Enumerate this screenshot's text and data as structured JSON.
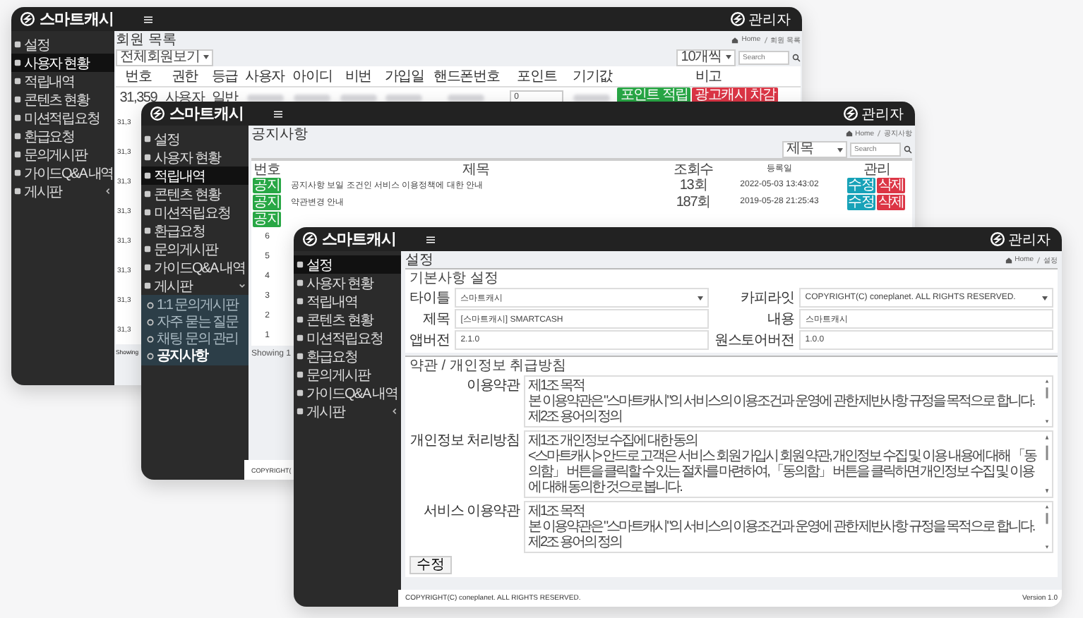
{
  "windows": [
    {
      "kind": "members",
      "logo": "스마트캐시",
      "admin": "관리자",
      "sidebar": [
        {
          "label": "설정",
          "selected": false
        },
        {
          "label": "사용자 현황",
          "selected": true
        },
        {
          "label": "적립내역",
          "selected": false
        },
        {
          "label": "콘텐츠 현황",
          "selected": false
        },
        {
          "label": "미션적립요청",
          "selected": false
        },
        {
          "label": "환급요청",
          "selected": false
        },
        {
          "label": "문의게시판",
          "selected": false
        },
        {
          "label": "가이드Q&A 내역",
          "selected": false
        },
        {
          "label": "게시판",
          "selected": false,
          "expanded": false
        }
      ],
      "title": "회원 목록",
      "breadcrumb": [
        "Home",
        "회원 목록"
      ],
      "filter": "전체회원보기",
      "page_size": "10개씩",
      "search": {
        "placeholder": "Search"
      },
      "table": {
        "columns": [
          "번호",
          "권한",
          "등급",
          "사용자",
          "아이디",
          "비번",
          "가입일",
          "핸드폰번호",
          "포인트",
          "기기값",
          "비고"
        ],
        "rows": [
          {
            "cells": [
              {
                "kind": "text",
                "text": "31,359"
              },
              {
                "kind": "text",
                "text": "사용자"
              },
              {
                "kind": "text",
                "text": "일반"
              },
              {
                "kind": "blur"
              },
              {
                "kind": "blur"
              },
              {
                "kind": "blur"
              },
              {
                "kind": "blur"
              },
              {
                "kind": "blur"
              },
              {
                "kind": "input",
                "value": "0"
              },
              {
                "kind": "blur"
              },
              {
                "kind": "buttons",
                "buttons": [
                  {
                    "label": "포인트 적립",
                    "color": "#28a745"
                  },
                  {
                    "label": "광고캐시 차감",
                    "color": "#dc3545"
                  }
                ]
              }
            ]
          },
          {
            "cells": [
              {
                "kind": "text",
                "text": "31,3"
              }
            ]
          },
          {
            "cells": [
              {
                "kind": "text",
                "text": "31,3"
              }
            ]
          },
          {
            "cells": [
              {
                "kind": "text",
                "text": "31,3"
              }
            ]
          },
          {
            "cells": [
              {
                "kind": "text",
                "text": "31,3"
              }
            ]
          },
          {
            "cells": [
              {
                "kind": "text",
                "text": "31,3"
              }
            ]
          },
          {
            "cells": [
              {
                "kind": "text",
                "text": "31,3"
              }
            ]
          },
          {
            "cells": [
              {
                "kind": "text",
                "text": "31,3"
              }
            ]
          },
          {
            "cells": [
              {
                "kind": "text",
                "text": "31,3"
              }
            ]
          }
        ]
      },
      "footer": "Showing"
    },
    {
      "kind": "notices",
      "logo": "스마트캐시",
      "admin": "관리자",
      "sidebar": [
        {
          "label": "설정",
          "selected": false
        },
        {
          "label": "사용자 현황",
          "selected": false
        },
        {
          "label": "적립내역",
          "selected": true
        },
        {
          "label": "콘텐츠 현황",
          "selected": false
        },
        {
          "label": "미션적립요청",
          "selected": false
        },
        {
          "label": "환급요청",
          "selected": false
        },
        {
          "label": "문의게시판",
          "selected": false
        },
        {
          "label": "가이드Q&A 내역",
          "selected": false
        },
        {
          "label": "게시판",
          "selected": false,
          "expanded": true,
          "children": [
            {
              "label": "1:1 문의게시판",
              "selected": false
            },
            {
              "label": "자주 묻는 질문",
              "selected": false
            },
            {
              "label": "채팅 문의 관리",
              "selected": false
            },
            {
              "label": "공지사항",
              "selected": true
            }
          ]
        }
      ],
      "title": "공지사항",
      "breadcrumb": [
        "Home",
        "공지사항"
      ],
      "filter": "제목",
      "search": {
        "placeholder": "Search"
      },
      "table": {
        "columns": [
          "번호",
          "제목",
          "조회수",
          "등록일",
          "관리"
        ],
        "rows": [
          {
            "badge": "공지",
            "title": "공지사항 보일 조건인 서비스 이용정책에 대한 안내",
            "views": "13회",
            "date": "2022-05-03 13:43:02",
            "actions": [
              {
                "label": "수정",
                "color": "#17a2b8"
              },
              {
                "label": "삭제",
                "color": "#dc3545"
              }
            ]
          },
          {
            "badge": "공지",
            "title": "약관변경 안내",
            "views": "187회",
            "date": "2019-05-28 21:25:43",
            "actions": [
              {
                "label": "수정",
                "color": "#17a2b8"
              },
              {
                "label": "삭제",
                "color": "#dc3545"
              }
            ]
          },
          {
            "badge": "공지"
          },
          {
            "number": "6"
          },
          {
            "number": "5"
          },
          {
            "number": "4"
          },
          {
            "number": "3"
          },
          {
            "number": "2"
          },
          {
            "number": "1"
          }
        ]
      },
      "footer": "Showing 1",
      "copyright": "COPYRIGHT("
    },
    {
      "kind": "settings",
      "logo": "스마트캐시",
      "admin": "관리자",
      "sidebar": [
        {
          "label": "설정",
          "selected": true
        },
        {
          "label": "사용자 현황",
          "selected": false
        },
        {
          "label": "적립내역",
          "selected": false
        },
        {
          "label": "콘텐츠 현황",
          "selected": false
        },
        {
          "label": "미션적립요청",
          "selected": false
        },
        {
          "label": "환급요청",
          "selected": false
        },
        {
          "label": "문의게시판",
          "selected": false
        },
        {
          "label": "가이드Q&A 내역",
          "selected": false
        },
        {
          "label": "게시판",
          "selected": false,
          "expanded": false
        }
      ],
      "title": "설정",
      "breadcrumb": [
        "Home",
        "설정"
      ],
      "basic": {
        "heading": "기본사항 설정",
        "fields": [
          {
            "label": "타이틀",
            "kind": "select",
            "value": "스마트캐시"
          },
          {
            "label": "카피라잇",
            "kind": "select",
            "value": "COPYRIGHT(C) coneplanet. ALL RIGHTS RESERVED."
          },
          {
            "label": "제목",
            "kind": "text",
            "value": "[스마트캐시] SMARTCASH"
          },
          {
            "label": "내용",
            "kind": "text",
            "value": "스마트캐시"
          },
          {
            "label": "앱버전",
            "kind": "text",
            "value": "2.1.0"
          },
          {
            "label": "원스토어버전",
            "kind": "text",
            "value": "1.0.0"
          }
        ]
      },
      "terms": {
        "heading": "약관 / 개인정보 취급방침",
        "items": [
          {
            "label": "이용약관",
            "lines": [
              "제1조 목적",
              "본 이용약관은 \"스마트캐시\"의 서비스의 이용조건과 운영에 관한 제반사항 규정을 목적으로 합니다.",
              "제2조 용어의 정의"
            ]
          },
          {
            "label": "개인정보 처리방침",
            "lines": [
              "제1조 개인정보 수집에 대한 동의",
              "<스마트캐시> 안드로 고객은 서비스 회원 가입시 회원 약관, 개인정보 수집 및 이용 내용에 대해 「동의함」 버튼을 클릭할 수 있는 절차를 마련하여, 「동의함」 버튼을 클릭하면 개인정보 수집 및 이용에 대해 동의한 것으로 봅니다."
            ]
          },
          {
            "label": "서비스 이용약관",
            "lines": [
              "제1조 목적",
              "본 이용약관은 \"스마트캐시\"의 서비스의 이용조건과 운영에 관한 제반사항 규정을 목적으로 합니다.",
              "제2조 용어의 정의"
            ]
          }
        ]
      },
      "submit": "수정",
      "copyright": "COPYRIGHT(C) coneplanet. ALL RIGHTS RESERVED.",
      "version": "Version 1.0"
    }
  ]
}
